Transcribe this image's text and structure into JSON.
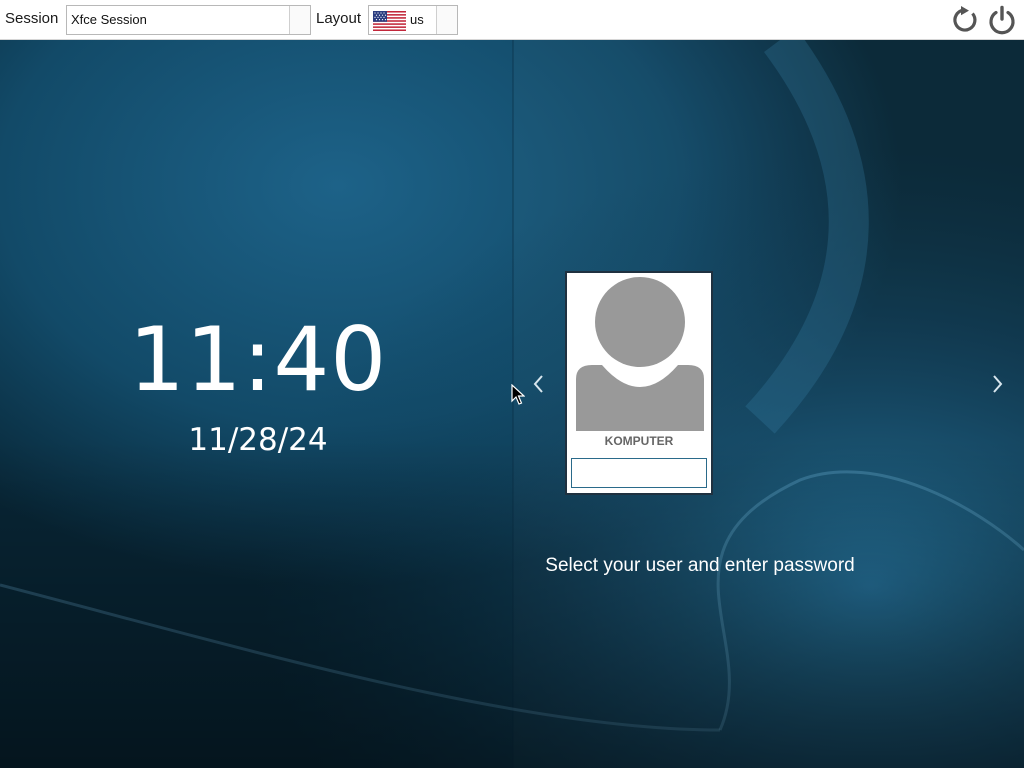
{
  "topbar": {
    "session_label": "Session",
    "session_value": "Xfce Session",
    "layout_label": "Layout",
    "layout_value": "us",
    "layout_flag": "us-flag-icon",
    "restart_icon": "restart-icon",
    "shutdown_icon": "power-icon"
  },
  "clock": {
    "time": "11:40",
    "date": "11/28/24"
  },
  "user_card": {
    "username": "KOMPUTER",
    "password_value": ""
  },
  "hint": "Select your user and enter password",
  "colors": {
    "background": "#0e3a52",
    "topbar": "#ffffff",
    "text": "#ffffff",
    "avatar": "#999999"
  }
}
